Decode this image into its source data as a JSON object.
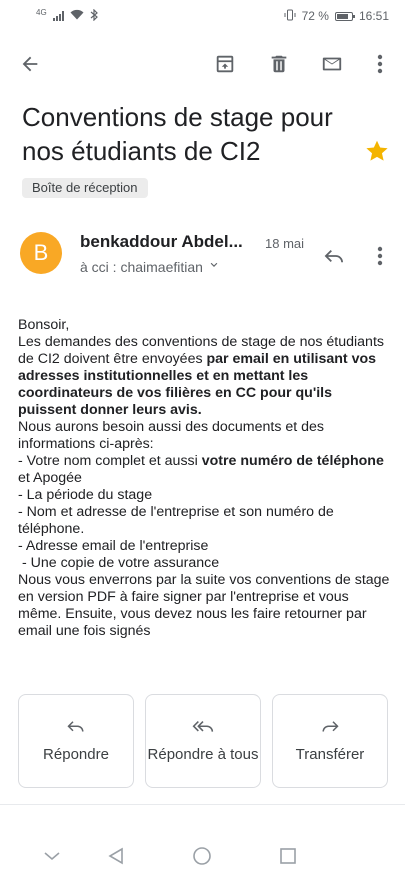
{
  "status_bar": {
    "network_label": "4G",
    "battery_percent": "72 %",
    "time": "16:51",
    "icons": [
      "signal-icon",
      "wifi-icon",
      "bluetooth-icon",
      "vibrate-icon",
      "battery-icon"
    ]
  },
  "toolbar": {
    "icons": [
      "back-arrow-icon",
      "archive-icon",
      "delete-icon",
      "mail-icon",
      "more-vert-icon"
    ]
  },
  "email": {
    "subject": "Conventions de stage pour nos étudiants de CI2",
    "starred": true,
    "label": "Boîte de réception",
    "sender": {
      "initial": "B",
      "name": "benkaddour Abdel...",
      "date": "18 mai",
      "recipient": "à cci : chaimaefitian"
    },
    "body": {
      "greeting": "Bonsoir,",
      "p1_start": "Les demandes des conventions de stage de nos étudiants de CI2 doivent être envoyées ",
      "p1_bold": "par email en utilisant vos adresses institutionnelles et en mettant les coordinateurs de vos filières en CC pour qu'ils puissent donner leurs avis.",
      "p2": "Nous aurons besoin aussi des documents et des informations ci-après:",
      "item1_start": "- Votre nom complet et aussi ",
      "item1_bold": "votre numéro  de téléphone",
      "item1_end": " et Apogée",
      "item2": "- La période du stage",
      "item3": "- Nom et adresse de  l'entreprise et son numéro de téléphone.",
      "item4": "- Adresse email de l'entreprise",
      "item5": " - Une copie de votre assurance",
      "p3": "Nous vous enverrons par la suite vos conventions de stage en version PDF à faire signer par l'entreprise et vous même. Ensuite, vous devez nous les faire retourner par email une fois signés"
    }
  },
  "actions": {
    "reply": "Répondre",
    "reply_all": "Répondre à tous",
    "forward": "Transférer"
  },
  "colors": {
    "avatar": "#f9a825",
    "star": "#f4b400",
    "icon": "#5f6368"
  }
}
